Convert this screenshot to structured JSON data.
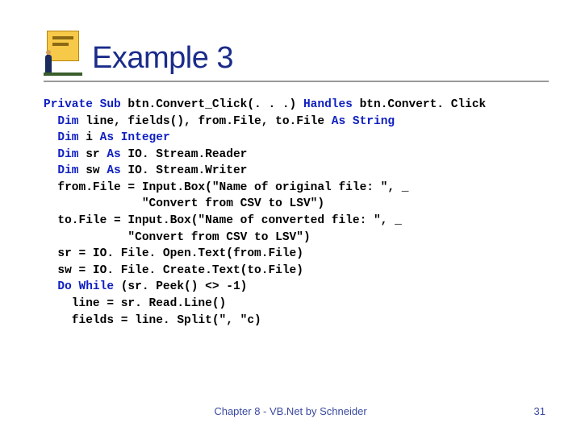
{
  "title": "Example 3",
  "code": {
    "l1a": "Private Sub",
    "l1b": " btn.Convert_Click(. . .) ",
    "l1c": "Handles",
    "l1d": " btn.Convert. Click",
    "l2a": "  Dim",
    "l2b": " line, fields(), from.File, to.File ",
    "l2c": "As String",
    "l3a": "  Dim",
    "l3b": " i ",
    "l3c": "As Integer",
    "l4a": "  Dim",
    "l4b": " sr ",
    "l4c": "As",
    "l4d": " IO. Stream.Reader",
    "l5a": "  Dim",
    "l5b": " sw ",
    "l5c": "As",
    "l5d": " IO. Stream.Writer",
    "l6": "  from.File = Input.Box(\"Name of original file: \", _",
    "l7": "              \"Convert from CSV to LSV\")",
    "l8": "  to.File = Input.Box(\"Name of converted file: \", _",
    "l9": "            \"Convert from CSV to LSV\")",
    "l10": "  sr = IO. File. Open.Text(from.File)",
    "l11": "  sw = IO. File. Create.Text(to.File)",
    "l12a": "  Do While",
    "l12b": " (sr. Peek() <> -1)",
    "l13": "    line = sr. Read.Line()",
    "l14": "    fields = line. Split(\", \"c)"
  },
  "footer": {
    "text": "Chapter 8 - VB.Net by Schneider",
    "page": "31"
  }
}
